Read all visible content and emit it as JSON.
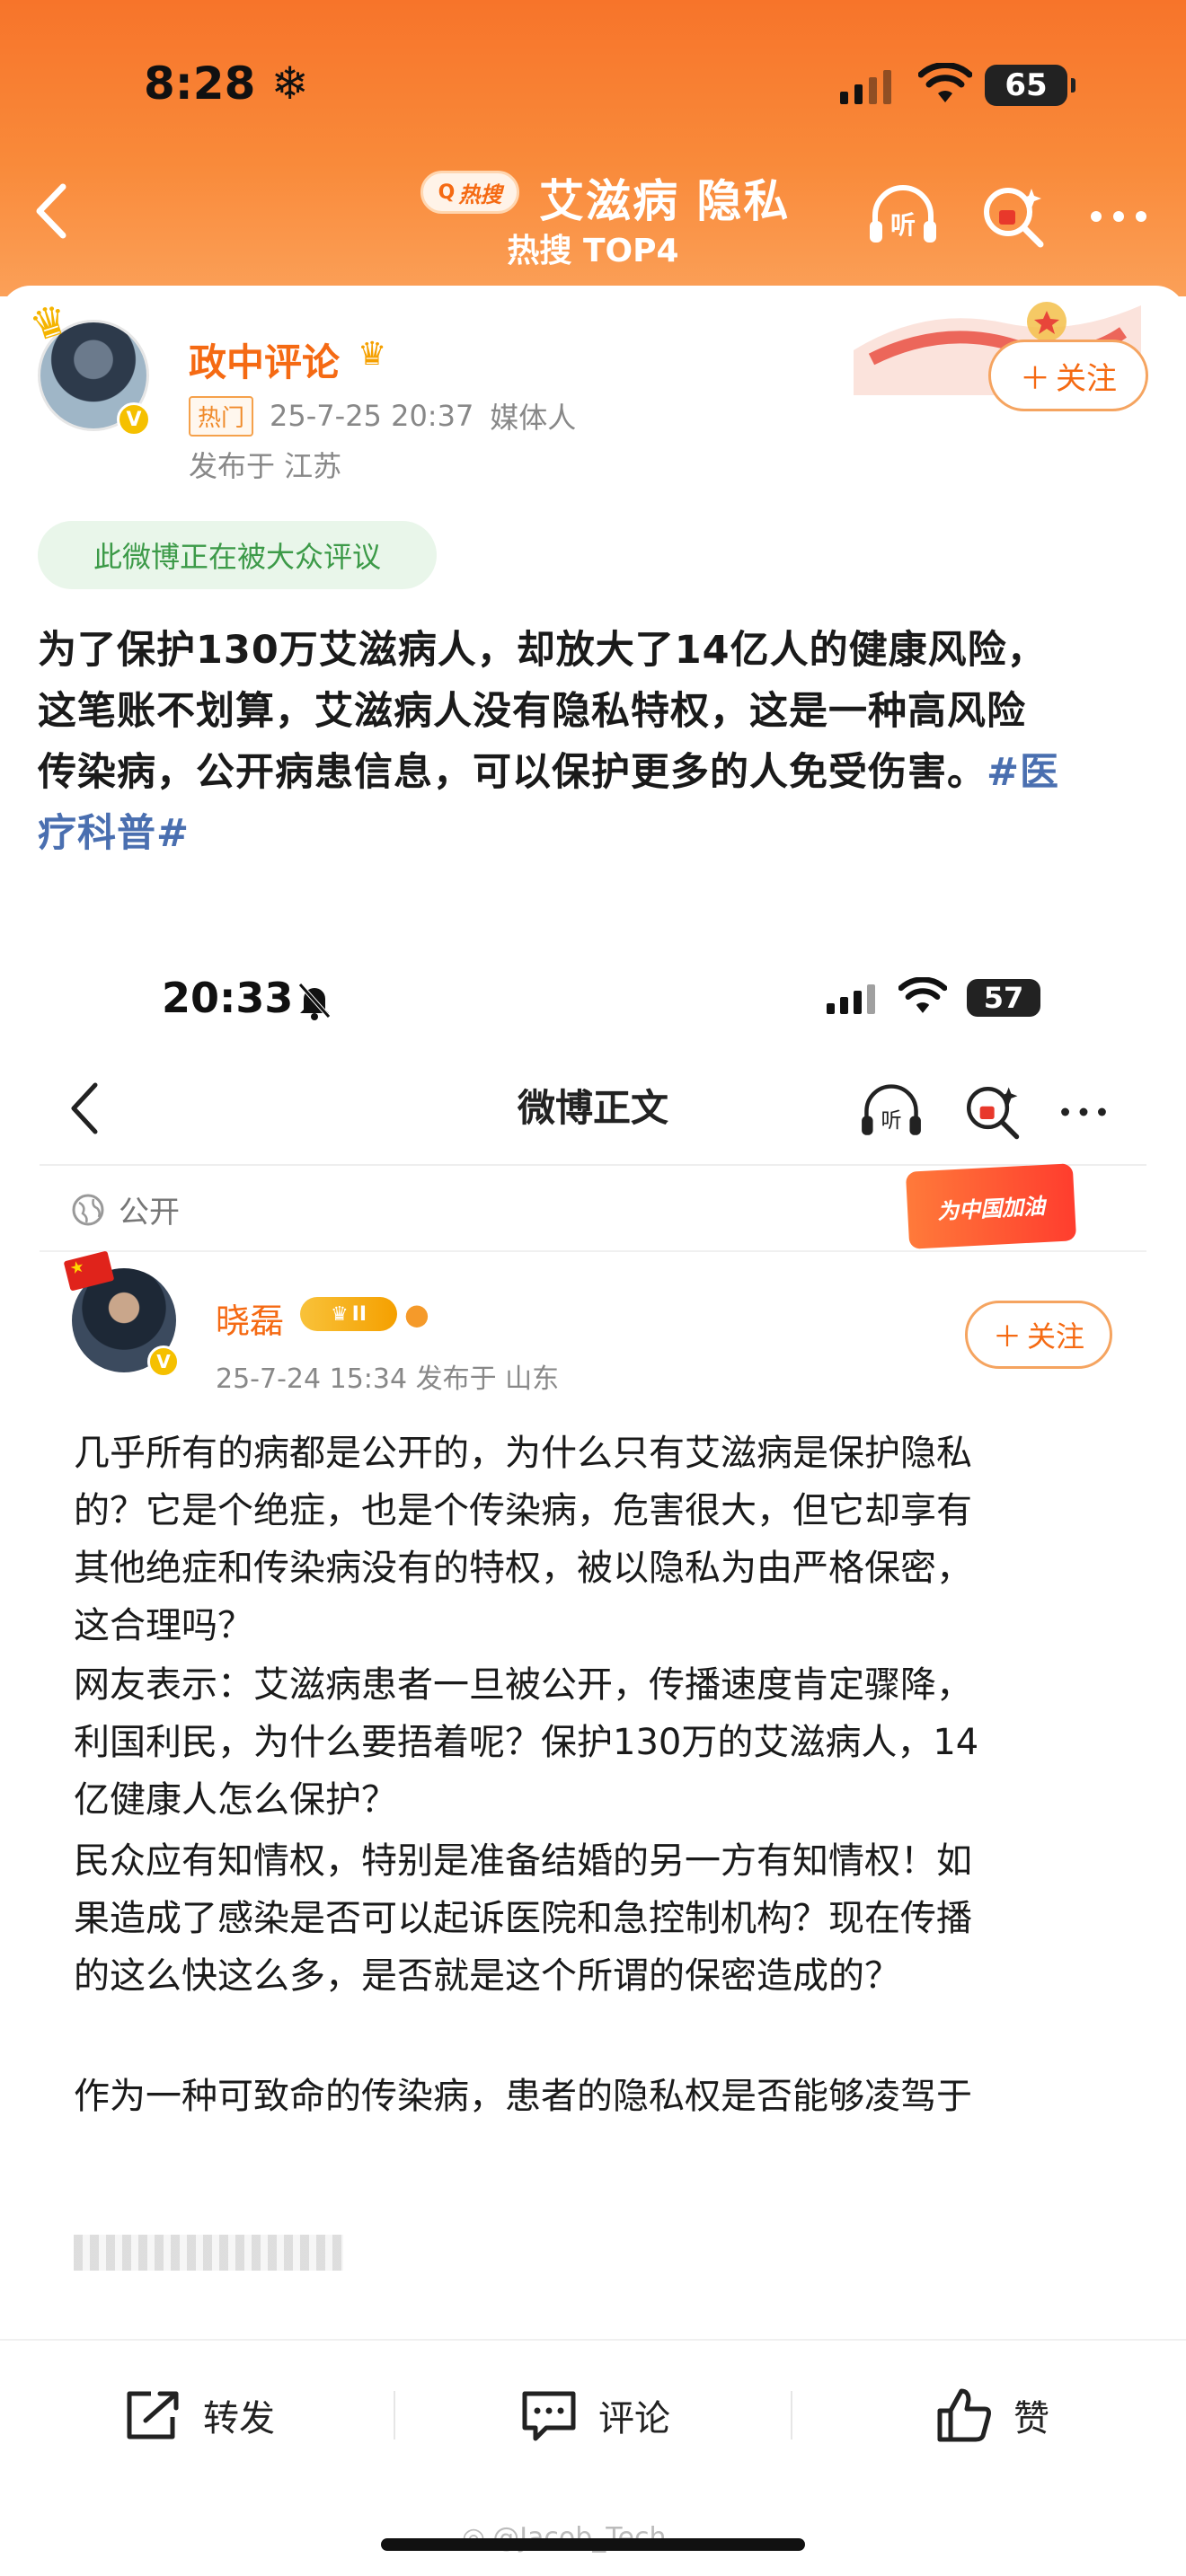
{
  "status_bar": {
    "time": "8:28",
    "snow_glyph": "❄",
    "battery": "65"
  },
  "header": {
    "hot_search_badge": "热搜",
    "topic_title": "艾滋病 隐私",
    "topic_subtitle": "热搜 TOP4",
    "icons": [
      "back-icon",
      "listen-icon",
      "search-icon",
      "more-icon"
    ],
    "listen_label": "听"
  },
  "post": {
    "author": "政中评论",
    "hot_tag": "热门",
    "timestamp": "25-7-25 20:37",
    "role": "媒体人",
    "location": "发布于 江苏",
    "follow_label": "关注",
    "discussion_badge": "此微博正在被大众评议",
    "text_line1": "为了保护130万艾滋病人，却放大了14亿人的健康风险，",
    "text_line2": "这笔账不划算，艾滋病人没有隐私特权，这是一种高风险",
    "text_line3_a": "传染病，公开病患信息，可以保护更多的人免受伤害。",
    "hashtag_a": "#医",
    "hashtag_b": "疗科普#"
  },
  "embedded": {
    "time": "20:33",
    "battery": "57",
    "page_title": "微博正文",
    "listen_label": "听",
    "visibility": "公开",
    "banner": "为中国加油",
    "author": "晓磊",
    "level_badge": "II",
    "meta": "25-7-24 15:34  发布于 山东",
    "follow_label": "关注",
    "paragraphs": [
      [
        "几乎所有的病都是公开的，为什么只有艾滋病是保护隐私",
        "的？它是个绝症，也是个传染病，危害很大，但它却享有",
        "其他绝症和传染病没有的特权，被以隐私为由严格保密，",
        "这合理吗？"
      ],
      [
        "网友表示：艾滋病患者一旦被公开，传播速度肯定骤降，",
        "利国利民，为什么要捂着呢？保护130万的艾滋病人，14",
        "亿健康人怎么保护？"
      ],
      [
        "民众应有知情权，特别是准备结婚的另一方有知情权！如",
        "果造成了感染是否可以起诉医院和急控制机构？现在传播",
        "的这么快这么多，是否就是这个所谓的保密造成的？"
      ],
      [
        "作为一种可致命的传染病，患者的隐私权是否能够凌驾于"
      ]
    ]
  },
  "actions": {
    "repost": "转发",
    "comment": "评论",
    "like": "赞"
  },
  "watermark": "@Jacob_Tech",
  "colors": {
    "brand_orange": "#f56a13",
    "header_top": "#f7742a",
    "hashtag_blue": "#4a6fb0",
    "discuss_green": "#3c9a48"
  }
}
